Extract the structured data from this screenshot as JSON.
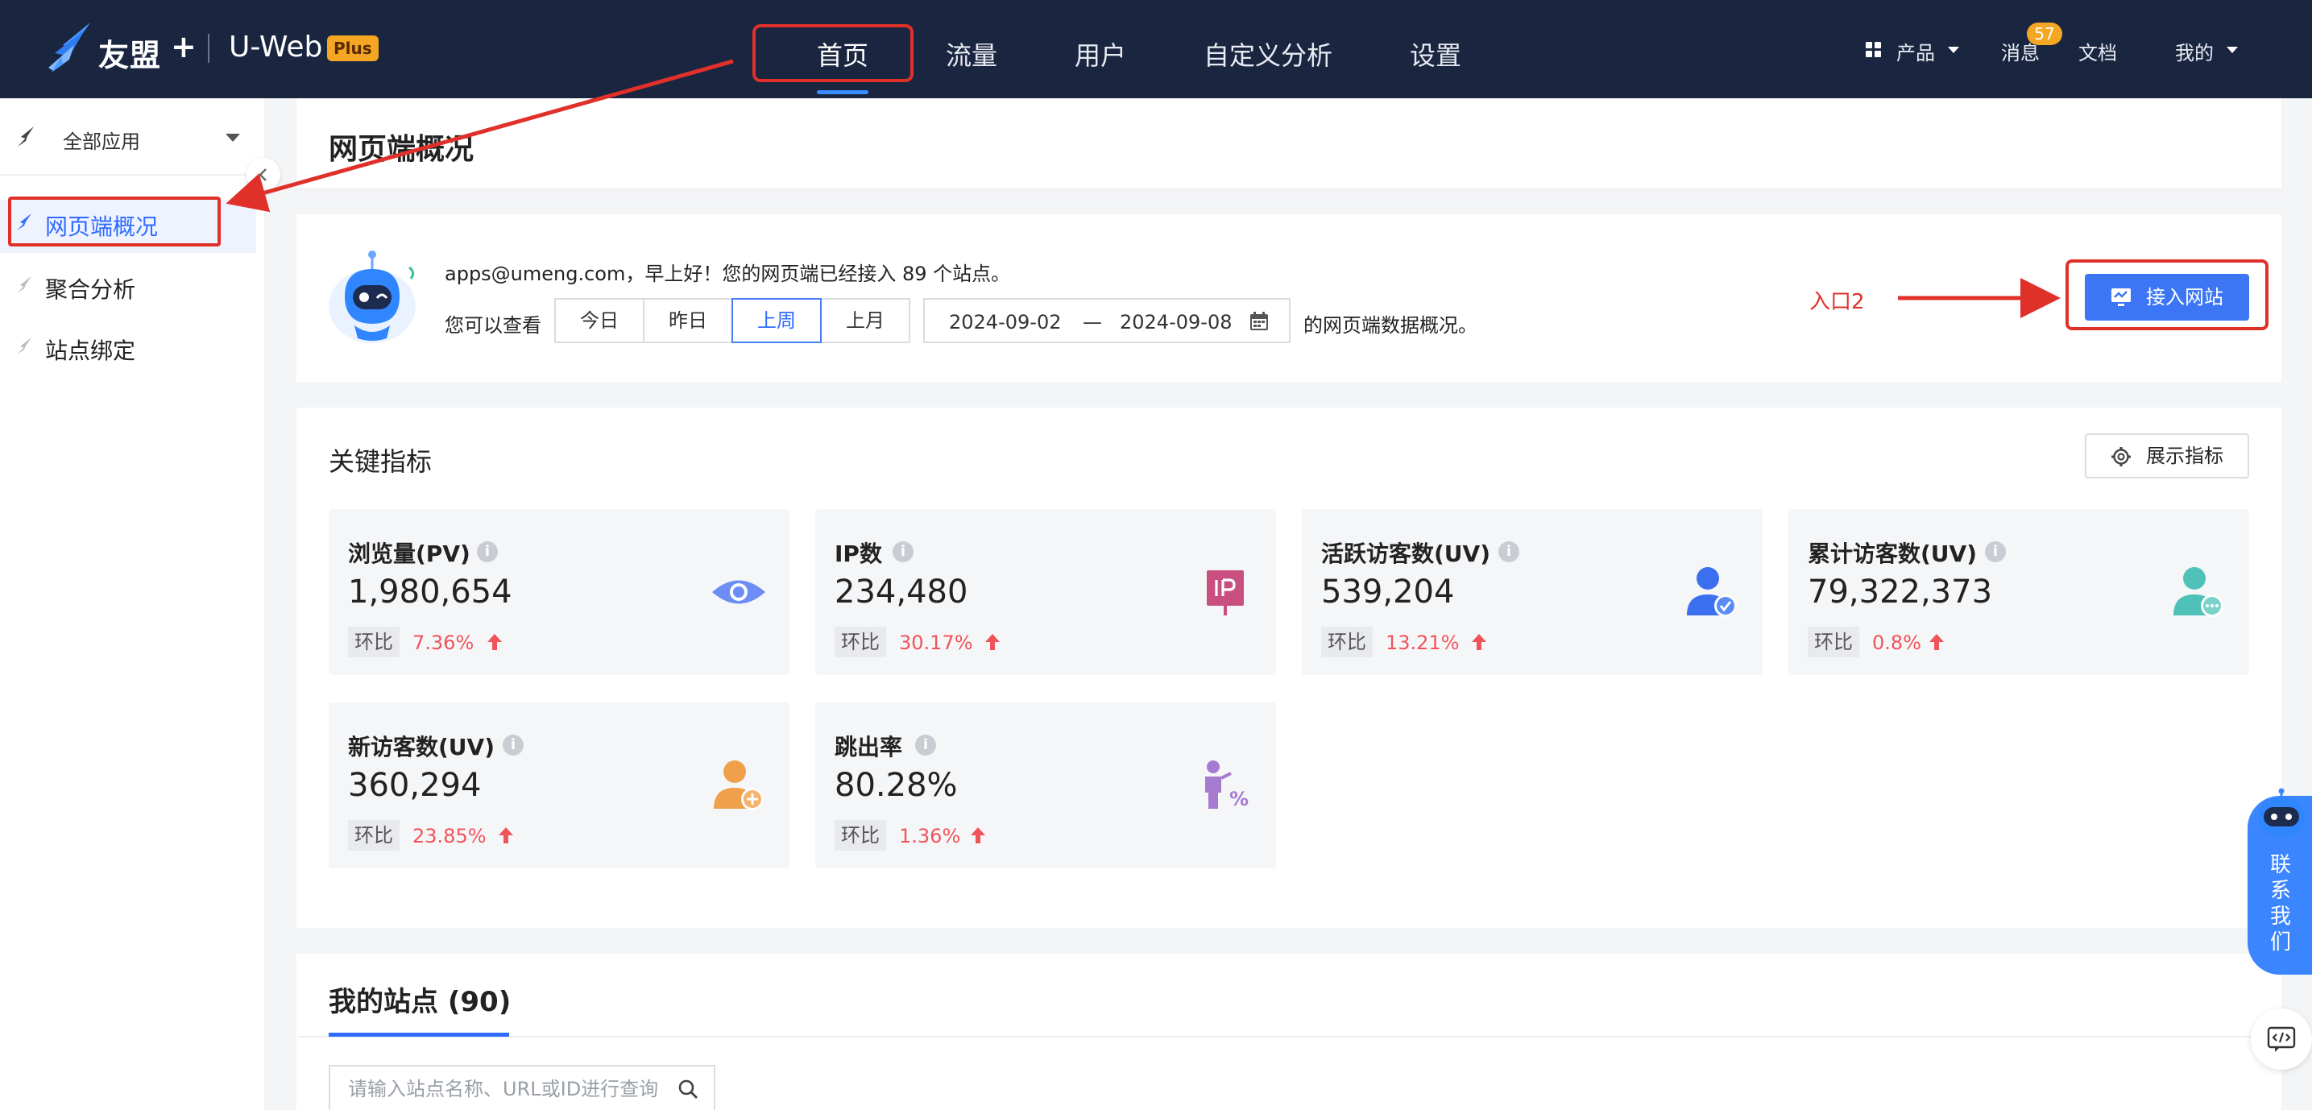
{
  "colors": {
    "nav_bg": "#1a2540",
    "accent": "#2f6bff",
    "primary_button": "#3c76f5",
    "badge": "#f5a623",
    "up_red": "#f0545a",
    "annotation_red": "#e0302a"
  },
  "header": {
    "brand": "友盟",
    "brand_plus": "+",
    "product": "U-Web",
    "plus_badge": "Plus",
    "nav": [
      "首页",
      "流量",
      "用户",
      "自定义分析",
      "设置"
    ],
    "active_nav": "首页",
    "right": {
      "products": "产品",
      "messages": "消息",
      "message_count": "57",
      "docs": "文档",
      "mine": "我的"
    }
  },
  "sidebar": {
    "app_selector": "全部应用",
    "items": [
      {
        "label": "网页端概况",
        "icon": "umeng-bird-icon",
        "active": true
      },
      {
        "label": "聚合分析",
        "icon": "umeng-bird-icon",
        "active": false
      },
      {
        "label": "站点绑定",
        "icon": "umeng-bird-icon",
        "active": false
      }
    ]
  },
  "page": {
    "title": "网页端概况",
    "greeting": "apps@umeng.com，早上好！您的网页端已经接入 89 个站点。",
    "view_label": "您可以查看",
    "ranges": [
      "今日",
      "昨日",
      "上周",
      "上月"
    ],
    "active_range": "上周",
    "date_start": "2024-09-02",
    "date_sep": "—",
    "date_end": "2024-09-08",
    "after_date": "的网页端数据概况。",
    "entry2_label": "入口2",
    "connect_button": "接入网站"
  },
  "metrics_section": {
    "title": "关键指标",
    "show_button": "展示指标",
    "ratio_label": "环比",
    "cards": [
      {
        "label": "浏览量(PV)",
        "value": "1,980,654",
        "ratio": "7.36%",
        "icon": "eye-icon"
      },
      {
        "label": "IP数",
        "value": "234,480",
        "ratio": "30.17%",
        "icon": "ip-sign-icon"
      },
      {
        "label": "活跃访客数(UV)",
        "value": "539,204",
        "ratio": "13.21%",
        "icon": "user-check-icon"
      },
      {
        "label": "累计访客数(UV)",
        "value": "79,322,373",
        "ratio": "0.8%",
        "icon": "user-more-icon"
      },
      {
        "label": "新访客数(UV)",
        "value": "360,294",
        "ratio": "23.85%",
        "icon": "user-add-icon"
      },
      {
        "label": "跳出率",
        "value": "80.28%",
        "ratio": "1.36%",
        "icon": "bounce-rate-icon"
      }
    ]
  },
  "sites": {
    "title": "我的站点 (90)",
    "search_placeholder": "请输入站点名称、URL或ID进行查询"
  },
  "contact": {
    "label": "联系我们"
  }
}
